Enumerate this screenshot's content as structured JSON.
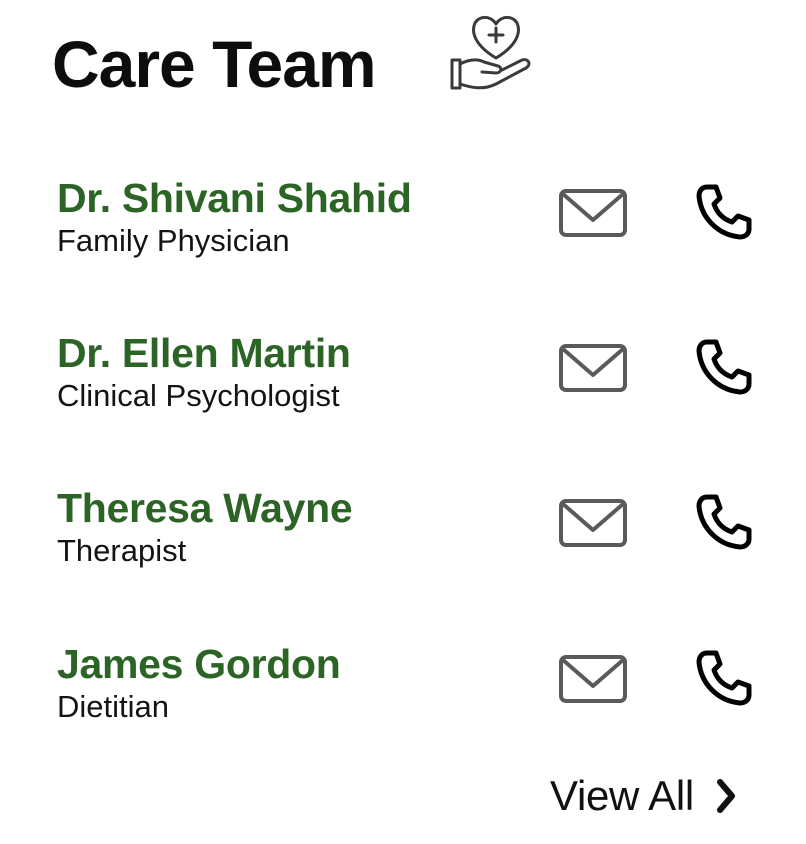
{
  "header": {
    "title": "Care Team",
    "icon": "heart-in-hand-icon"
  },
  "members": [
    {
      "name": "Dr. Shivani Shahid",
      "role": "Family Physician"
    },
    {
      "name": "Dr. Ellen Martin",
      "role": "Clinical Psychologist"
    },
    {
      "name": "Theresa Wayne",
      "role": "Therapist"
    },
    {
      "name": "James Gordon",
      "role": "Dietitian"
    }
  ],
  "actions": {
    "mail_icon": "mail-icon",
    "phone_icon": "phone-icon"
  },
  "footer": {
    "view_all_label": "View All",
    "chevron_icon": "chevron-right-icon"
  },
  "colors": {
    "name_green": "#2c6426",
    "icon_gray": "#5a5a5a",
    "text_dark": "#111111"
  }
}
